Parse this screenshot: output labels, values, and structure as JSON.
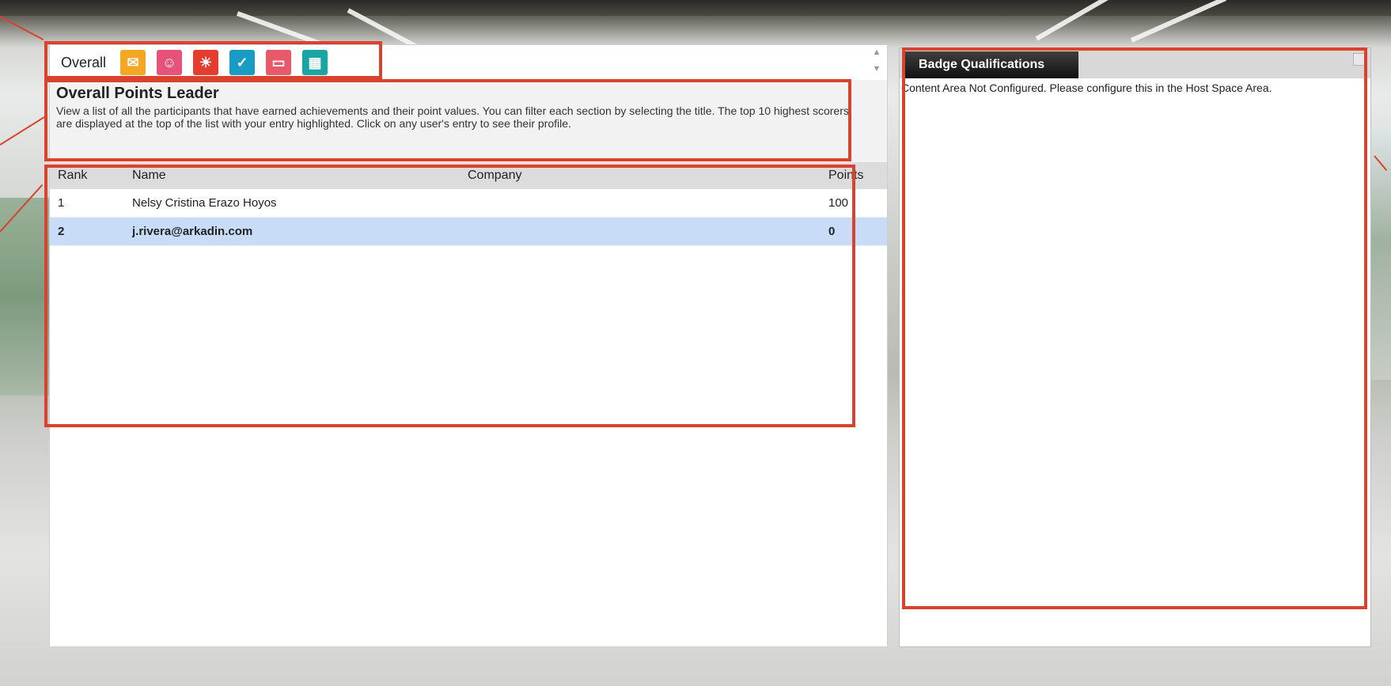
{
  "leaderboard": {
    "tabs": {
      "overall_label": "Overall",
      "icons": [
        {
          "name": "achievements-icon",
          "color": "#f5a623",
          "glyph": "✉"
        },
        {
          "name": "people-icon",
          "color": "#e8517a",
          "glyph": "☺"
        },
        {
          "name": "idea-icon",
          "color": "#e63c2e",
          "glyph": "☀"
        },
        {
          "name": "like-icon",
          "color": "#1a9bc4",
          "glyph": "✓"
        },
        {
          "name": "presentation-icon",
          "color": "#e85a6a",
          "glyph": "▭"
        },
        {
          "name": "calendar-icon",
          "color": "#1aa5a5",
          "glyph": "▦"
        }
      ]
    },
    "intro": {
      "title": "Overall Points Leader",
      "description": "View a list of all the participants that have earned achievements and their point values. You can filter each section by selecting the title. The top 10 highest scorers are displayed at the top of the list with your entry highlighted. Click on any user's entry to see their profile."
    },
    "table": {
      "headers": {
        "rank": "Rank",
        "name": "Name",
        "company": "Company",
        "points": "Points"
      },
      "rows": [
        {
          "rank": "1",
          "name": "Nelsy Cristina Erazo Hoyos",
          "company": "",
          "points": "100",
          "highlighted": false
        },
        {
          "rank": "2",
          "name": "j.rivera@arkadin.com",
          "company": "",
          "points": "0",
          "highlighted": true
        }
      ]
    }
  },
  "badge_panel": {
    "tab_label": "Badge Qualifications",
    "content": "Content Area Not Configured. Please configure this in the Host Space Area."
  },
  "colors": {
    "annotation": "#d9432e",
    "row_highlight": "#c8dcf8"
  }
}
